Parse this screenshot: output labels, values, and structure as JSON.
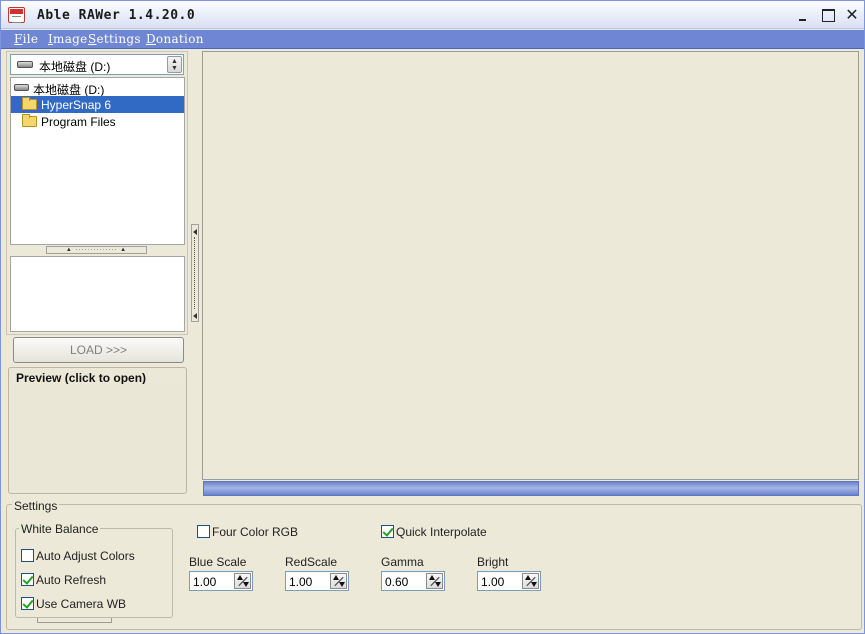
{
  "window": {
    "title": "Able RAWer 1.4.20.0",
    "min_label": "",
    "max_label": "",
    "close_label": "✕"
  },
  "menu": [
    {
      "label": "File",
      "u": "F",
      "rest": "ile"
    },
    {
      "label": "Image",
      "u": "I",
      "rest": "mage"
    },
    {
      "label": "Settings",
      "u": "S",
      "rest": "ettings"
    },
    {
      "label": "Donation",
      "u": "D",
      "rest": "onation"
    }
  ],
  "browser": {
    "drive_select": "本地磁盘 (D:)",
    "tree": [
      {
        "label": "本地磁盘 (D:)",
        "icon": "drive-icon",
        "selected": false
      },
      {
        "label": "HyperSnap 6",
        "icon": "folder-icon",
        "selected": true
      },
      {
        "label": "Program Files",
        "icon": "folder-icon",
        "selected": false
      }
    ],
    "load_button": "LOAD >>>",
    "preview_title": "Preview (click to open)"
  },
  "settings": {
    "legend": "Settings",
    "white_balance": {
      "legend": "White Balance",
      "options": [
        {
          "label": "Auto Adjust Colors",
          "checked": false
        },
        {
          "label": "Auto Refresh",
          "checked": true
        },
        {
          "label": "Use Camera WB",
          "checked": true
        }
      ]
    },
    "four_color_rgb": {
      "label": "Four Color RGB",
      "checked": false
    },
    "quick_interpolate": {
      "label": "Quick Interpolate",
      "checked": true
    },
    "fields": [
      {
        "label": "Blue Scale",
        "value": "1.00"
      },
      {
        "label": "RedScale",
        "value": "1.00"
      },
      {
        "label": "Gamma",
        "value": "0.60"
      },
      {
        "label": "Bright",
        "value": "1.00"
      }
    ]
  },
  "colors": {
    "window_bg": "#ece9d8",
    "menubar": "#6e86d4",
    "selection": "#316ac5",
    "progress": "#6b83ce"
  }
}
